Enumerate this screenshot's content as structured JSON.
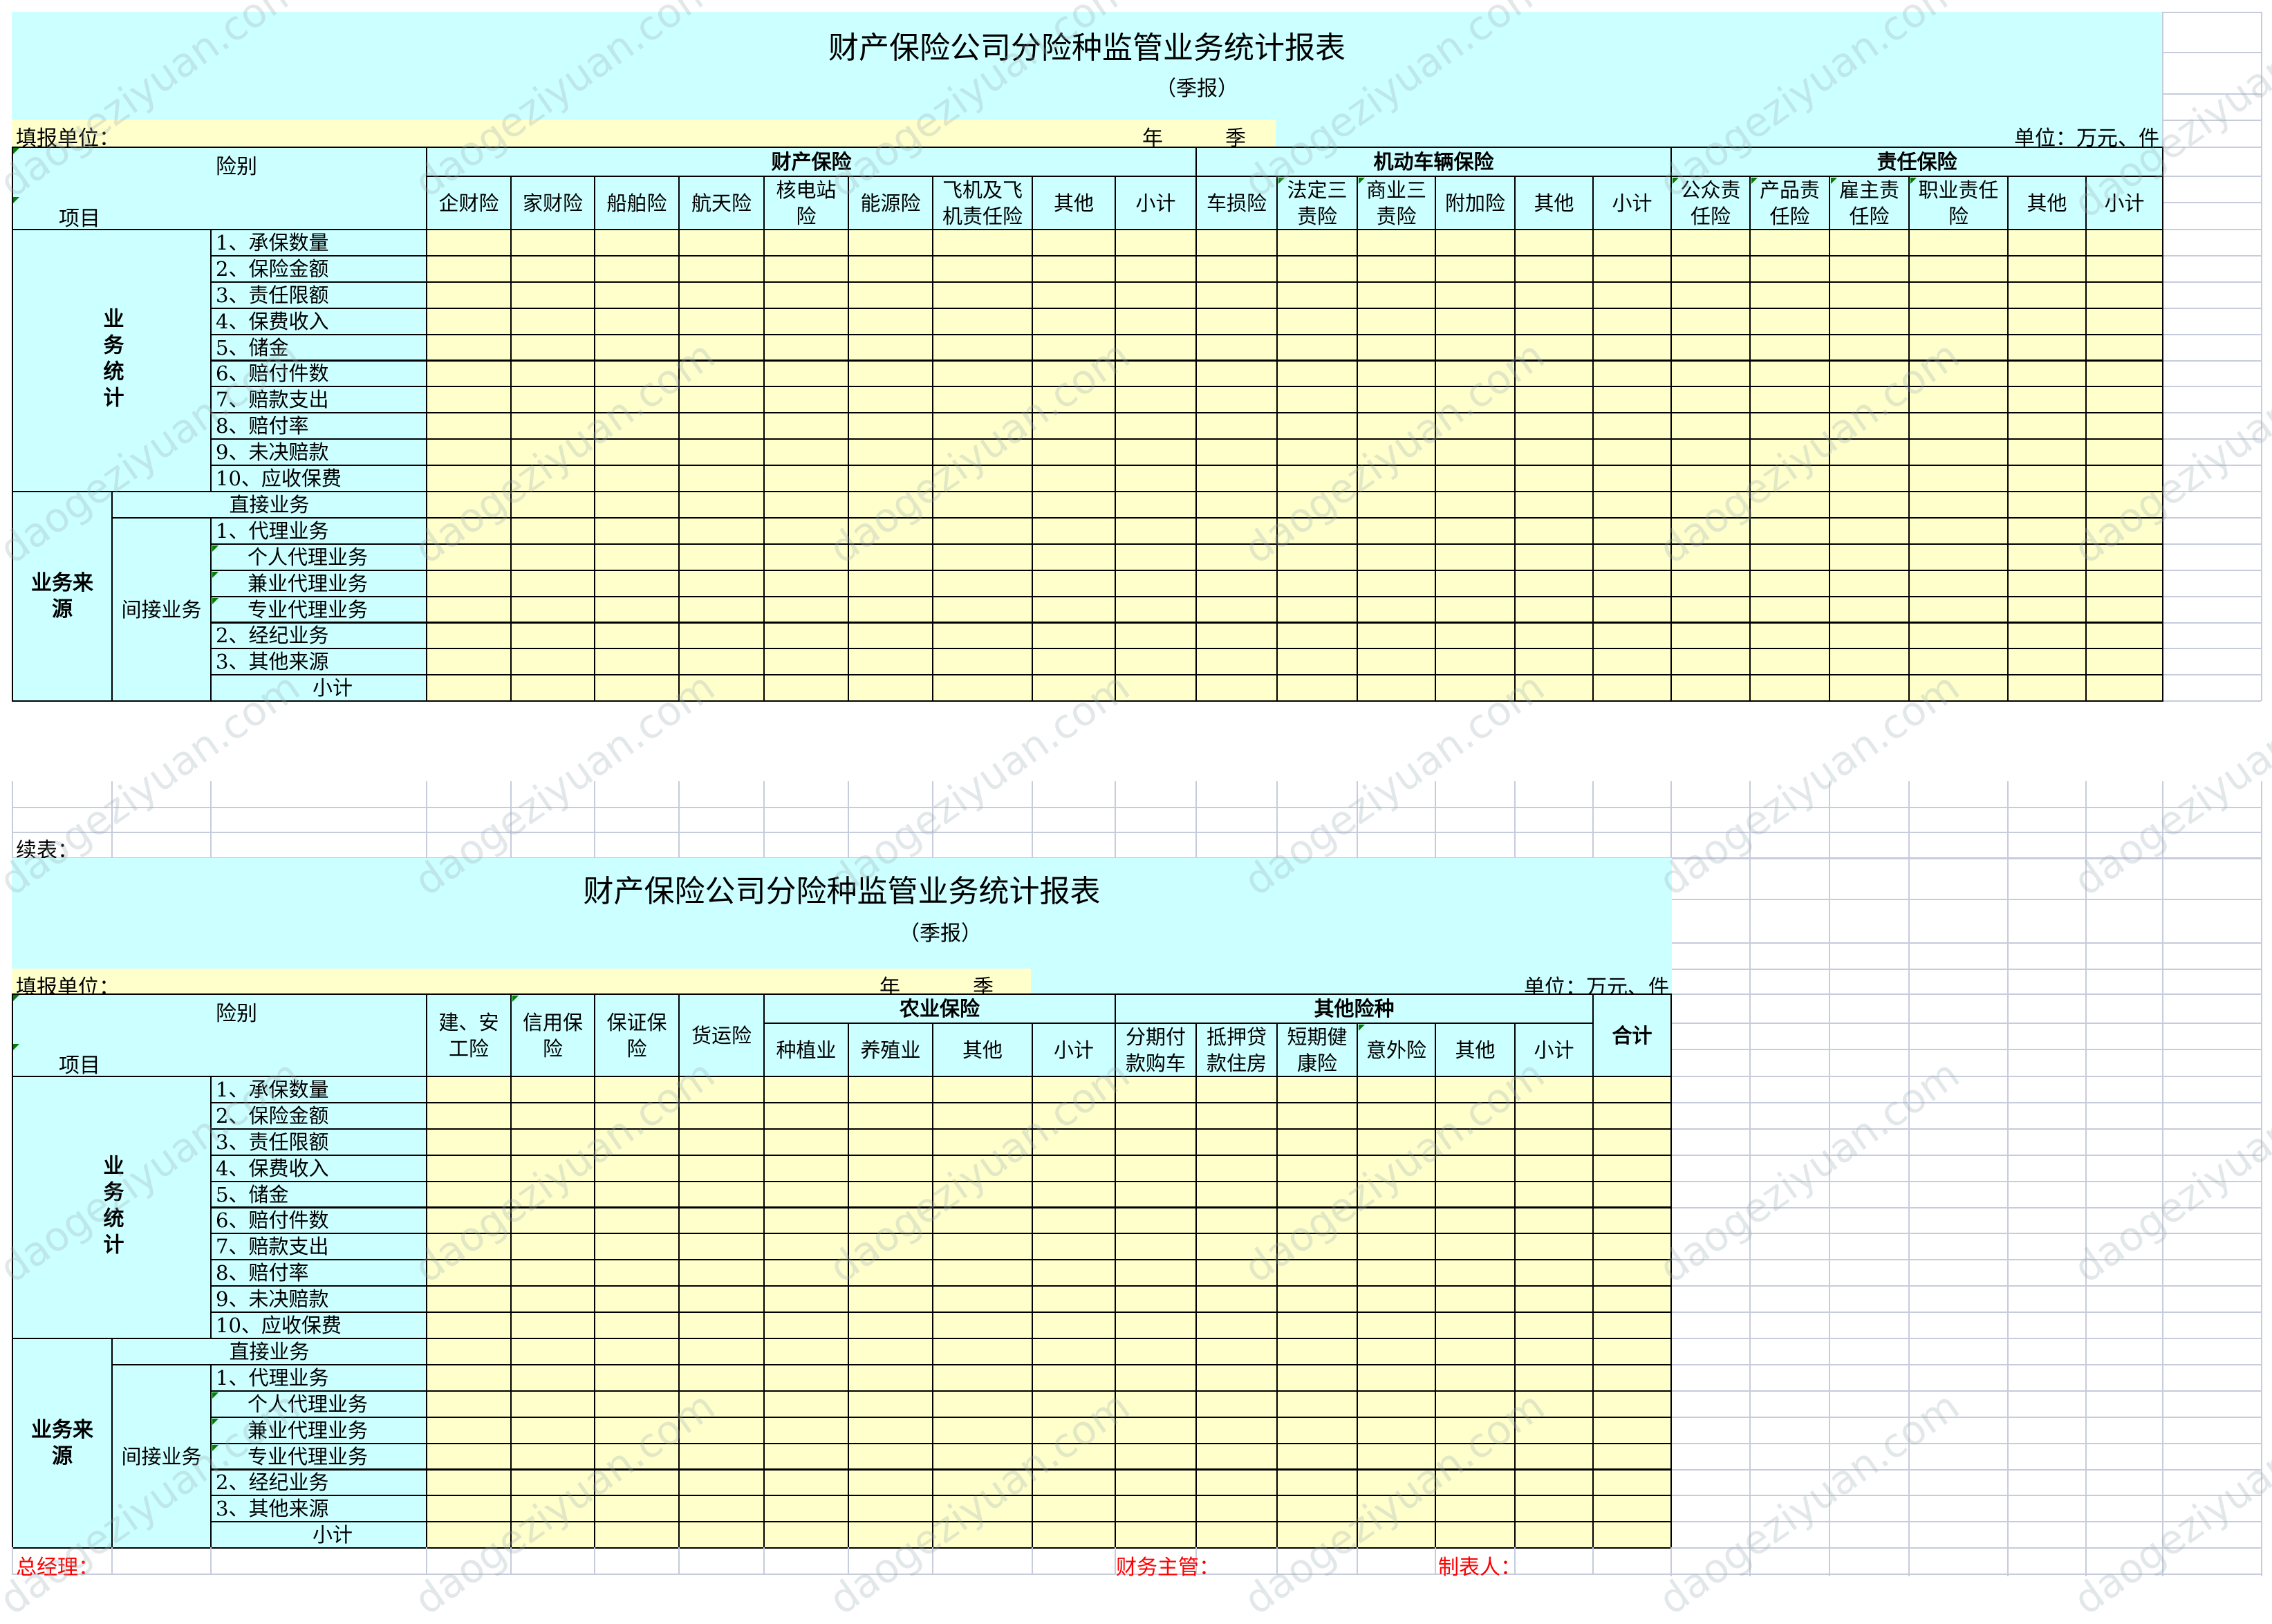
{
  "sheet": {
    "colors": {
      "header_fill": "#ccffff",
      "input_fill": "#ffffcc",
      "grid": "#c6ccdc",
      "signature_text": "#ff0000",
      "comment_marker": "#008000"
    },
    "watermark": "daogeziyuan.com"
  },
  "table1": {
    "title": "财产保险公司分险种监管业务统计报表",
    "subtitle": "（季报）",
    "fill_unit_label": "填报单位：",
    "year_label": "年",
    "quarter_label": "季",
    "unit_label": "单位：万元、件",
    "corner_top": "险别",
    "corner_bottom": "项目",
    "groups": [
      {
        "label": "财产保险",
        "columns": [
          "企财险",
          "家财险",
          "船舶险",
          "航天险",
          "核电站险",
          "能源险",
          "飞机及飞机责任险",
          "其他",
          "小计"
        ]
      },
      {
        "label": "机动车辆保险",
        "columns": [
          "车损险",
          "法定三责险",
          "商业三责险",
          "附加险",
          "其他",
          "小计"
        ]
      },
      {
        "label": "责任保险",
        "columns": [
          "公众责任险",
          "产品责任险",
          "雇主责任险",
          "职业责任险",
          "其他",
          "小计"
        ]
      }
    ]
  },
  "table2": {
    "continued_label": "续表：",
    "title": "财产保险公司分险种监管业务统计报表",
    "subtitle": "（季报）",
    "fill_unit_label": "填报单位：",
    "year_label": "年",
    "quarter_label": "季",
    "unit_label": "单位：万元、件",
    "corner_top": "险别",
    "corner_bottom": "项目",
    "single_columns": [
      "建、安工险",
      "信用保险",
      "保证保险",
      "货运险"
    ],
    "groups": [
      {
        "label": "农业保险",
        "columns": [
          "种植业",
          "养殖业",
          "其他",
          "小计"
        ]
      },
      {
        "label": "其他险种",
        "columns": [
          "分期付款购车",
          "抵押贷款住房",
          "短期健康险",
          "意外险",
          "其他",
          "小计"
        ]
      }
    ],
    "total_column": "合计",
    "footer": {
      "general_manager": "总经理：",
      "finance_supervisor": "财务主管：",
      "preparer": "制表人："
    }
  },
  "rows": {
    "business_stats_label": "业务统计",
    "business_stats_items": [
      "1、承保数量",
      "2、保险金额",
      "3、责任限额",
      "4、保费收入",
      "5、储金",
      "6、赔付件数",
      "7、赔款支出",
      "8、赔付率",
      "9、未决赔款",
      "10、应收保费"
    ],
    "business_source_label": "业务来源",
    "direct_business": "直接业务",
    "indirect_business": "间接业务",
    "indirect_items": [
      {
        "label": "1、代理业务",
        "indent": false
      },
      {
        "label": "个人代理业务",
        "indent": true
      },
      {
        "label": "兼业代理业务",
        "indent": true
      },
      {
        "label": "专业代理业务",
        "indent": true
      },
      {
        "label": "2、经纪业务",
        "indent": false
      },
      {
        "label": "3、其他来源",
        "indent": false
      }
    ],
    "subtotal": "小计"
  }
}
